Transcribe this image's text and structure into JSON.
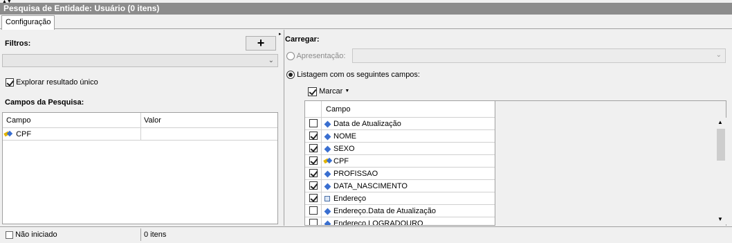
{
  "window": {
    "title": "Pesquisa de Entidade: Usuário (0 itens)"
  },
  "tabs": [
    {
      "label": "Configuração"
    }
  ],
  "left": {
    "filters_label": "Filtros:",
    "add_button_label": "+",
    "filter_combo_value": "",
    "explore_single_label": "Explorar resultado único",
    "explore_single_checked": true,
    "search_fields_label": "Campos da Pesquisa:",
    "grid": {
      "columns": [
        "Campo",
        "Valor"
      ],
      "rows": [
        {
          "field": "CPF",
          "value": "",
          "icon": "key-icon"
        }
      ]
    }
  },
  "right": {
    "load_label": "Carregar:",
    "presentation_label": "Apresentação:",
    "presentation_selected": false,
    "presentation_value": "",
    "listing_label": "Listagem com os seguintes campos:",
    "listing_selected": true,
    "mark_label": "Marcar",
    "mark_checked": true,
    "grid": {
      "column": "Campo",
      "rows": [
        {
          "label": "Data de Atualização",
          "checked": false,
          "icon": "diamond-icon"
        },
        {
          "label": "NOME",
          "checked": true,
          "icon": "diamond-icon"
        },
        {
          "label": "SEXO",
          "checked": true,
          "icon": "diamond-icon"
        },
        {
          "label": "CPF",
          "checked": true,
          "icon": "key-icon"
        },
        {
          "label": "PROFISSAO",
          "checked": true,
          "icon": "diamond-icon"
        },
        {
          "label": "DATA_NASCIMENTO",
          "checked": true,
          "icon": "diamond-icon"
        },
        {
          "label": "Endereço",
          "checked": true,
          "icon": "entity-icon"
        },
        {
          "label": "Endereço.Data de Atualização",
          "checked": false,
          "icon": "diamond-icon"
        },
        {
          "label": "Endereço.LOGRADOURO",
          "checked": false,
          "icon": "diamond-icon"
        }
      ]
    }
  },
  "status": {
    "state": "Não iniciado",
    "count": "0 itens"
  }
}
